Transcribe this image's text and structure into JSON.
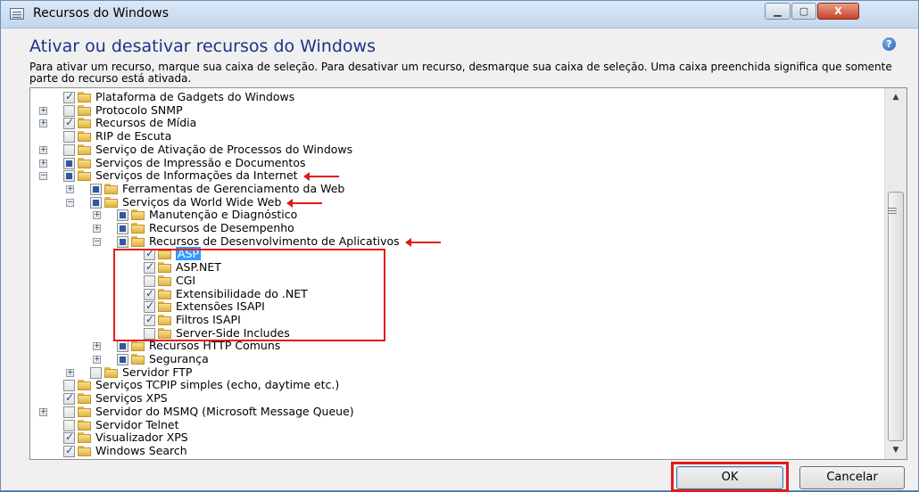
{
  "window": {
    "title": "Recursos do Windows",
    "minimize_glyph": "▁",
    "maximize_glyph": "▢",
    "close_glyph": "X"
  },
  "heading": "Ativar ou desativar recursos do Windows",
  "help_glyph": "?",
  "description": "Para ativar um recurso, marque sua caixa de seleção. Para desativar um recurso, desmarque sua caixa de seleção. Uma caixa preenchida significa que somente parte do recurso está ativada.",
  "tree": [
    {
      "label": "Plataforma de Gadgets do Windows",
      "level": 0,
      "expander": "",
      "state": "checked"
    },
    {
      "label": "Protocolo SNMP",
      "level": 0,
      "expander": "+",
      "state": "unchecked"
    },
    {
      "label": "Recursos de Mídia",
      "level": 0,
      "expander": "+",
      "state": "checked"
    },
    {
      "label": "RIP de Escuta",
      "level": 0,
      "expander": "",
      "state": "unchecked"
    },
    {
      "label": "Serviço de Ativação de Processos do Windows",
      "level": 0,
      "expander": "+",
      "state": "unchecked"
    },
    {
      "label": "Serviços de Impressão e Documentos",
      "level": 0,
      "expander": "+",
      "state": "partial"
    },
    {
      "label": "Serviços de Informações da Internet",
      "level": 0,
      "expander": "−",
      "state": "partial",
      "marked": true
    },
    {
      "label": "Ferramentas de Gerenciamento da Web",
      "level": 1,
      "expander": "+",
      "state": "partial"
    },
    {
      "label": "Serviços da World Wide Web",
      "level": 1,
      "expander": "−",
      "state": "partial",
      "marked": true
    },
    {
      "label": "Manutenção e Diagnóstico",
      "level": 2,
      "expander": "+",
      "state": "partial"
    },
    {
      "label": "Recursos de Desempenho",
      "level": 2,
      "expander": "+",
      "state": "partial"
    },
    {
      "label": "Recursos de Desenvolvimento de Aplicativos",
      "level": 2,
      "expander": "−",
      "state": "partial",
      "marked": true
    },
    {
      "label": "ASP",
      "level": 3,
      "expander": "",
      "state": "checked",
      "selected": true
    },
    {
      "label": "ASP.NET",
      "level": 3,
      "expander": "",
      "state": "checked"
    },
    {
      "label": "CGI",
      "level": 3,
      "expander": "",
      "state": "unchecked"
    },
    {
      "label": "Extensibilidade do .NET",
      "level": 3,
      "expander": "",
      "state": "checked"
    },
    {
      "label": "Extensões ISAPI",
      "level": 3,
      "expander": "",
      "state": "checked"
    },
    {
      "label": "Filtros ISAPI",
      "level": 3,
      "expander": "",
      "state": "checked"
    },
    {
      "label": "Server-Side Includes",
      "level": 3,
      "expander": "",
      "state": "unchecked"
    },
    {
      "label": "Recursos HTTP Comuns",
      "level": 2,
      "expander": "+",
      "state": "partial"
    },
    {
      "label": "Segurança",
      "level": 2,
      "expander": "+",
      "state": "partial"
    },
    {
      "label": "Servidor FTP",
      "level": 1,
      "expander": "+",
      "state": "unchecked"
    },
    {
      "label": "Serviços TCPIP simples (echo, daytime etc.)",
      "level": 0,
      "expander": "",
      "state": "unchecked"
    },
    {
      "label": "Serviços XPS",
      "level": 0,
      "expander": "",
      "state": "checked"
    },
    {
      "label": "Servidor do MSMQ (Microsoft Message Queue)",
      "level": 0,
      "expander": "+",
      "state": "unchecked"
    },
    {
      "label": "Servidor Telnet",
      "level": 0,
      "expander": "",
      "state": "unchecked"
    },
    {
      "label": "Visualizador XPS",
      "level": 0,
      "expander": "",
      "state": "checked"
    },
    {
      "label": "Windows Search",
      "level": 0,
      "expander": "",
      "state": "checked"
    }
  ],
  "scrollbar": {
    "up_glyph": "▲",
    "down_glyph": "▼"
  },
  "buttons": {
    "ok": "OK",
    "cancel": "Cancelar"
  },
  "colors": {
    "annotation_red": "#e31b1b",
    "heading_blue": "#1e3287",
    "selection_blue": "#3399ff"
  }
}
